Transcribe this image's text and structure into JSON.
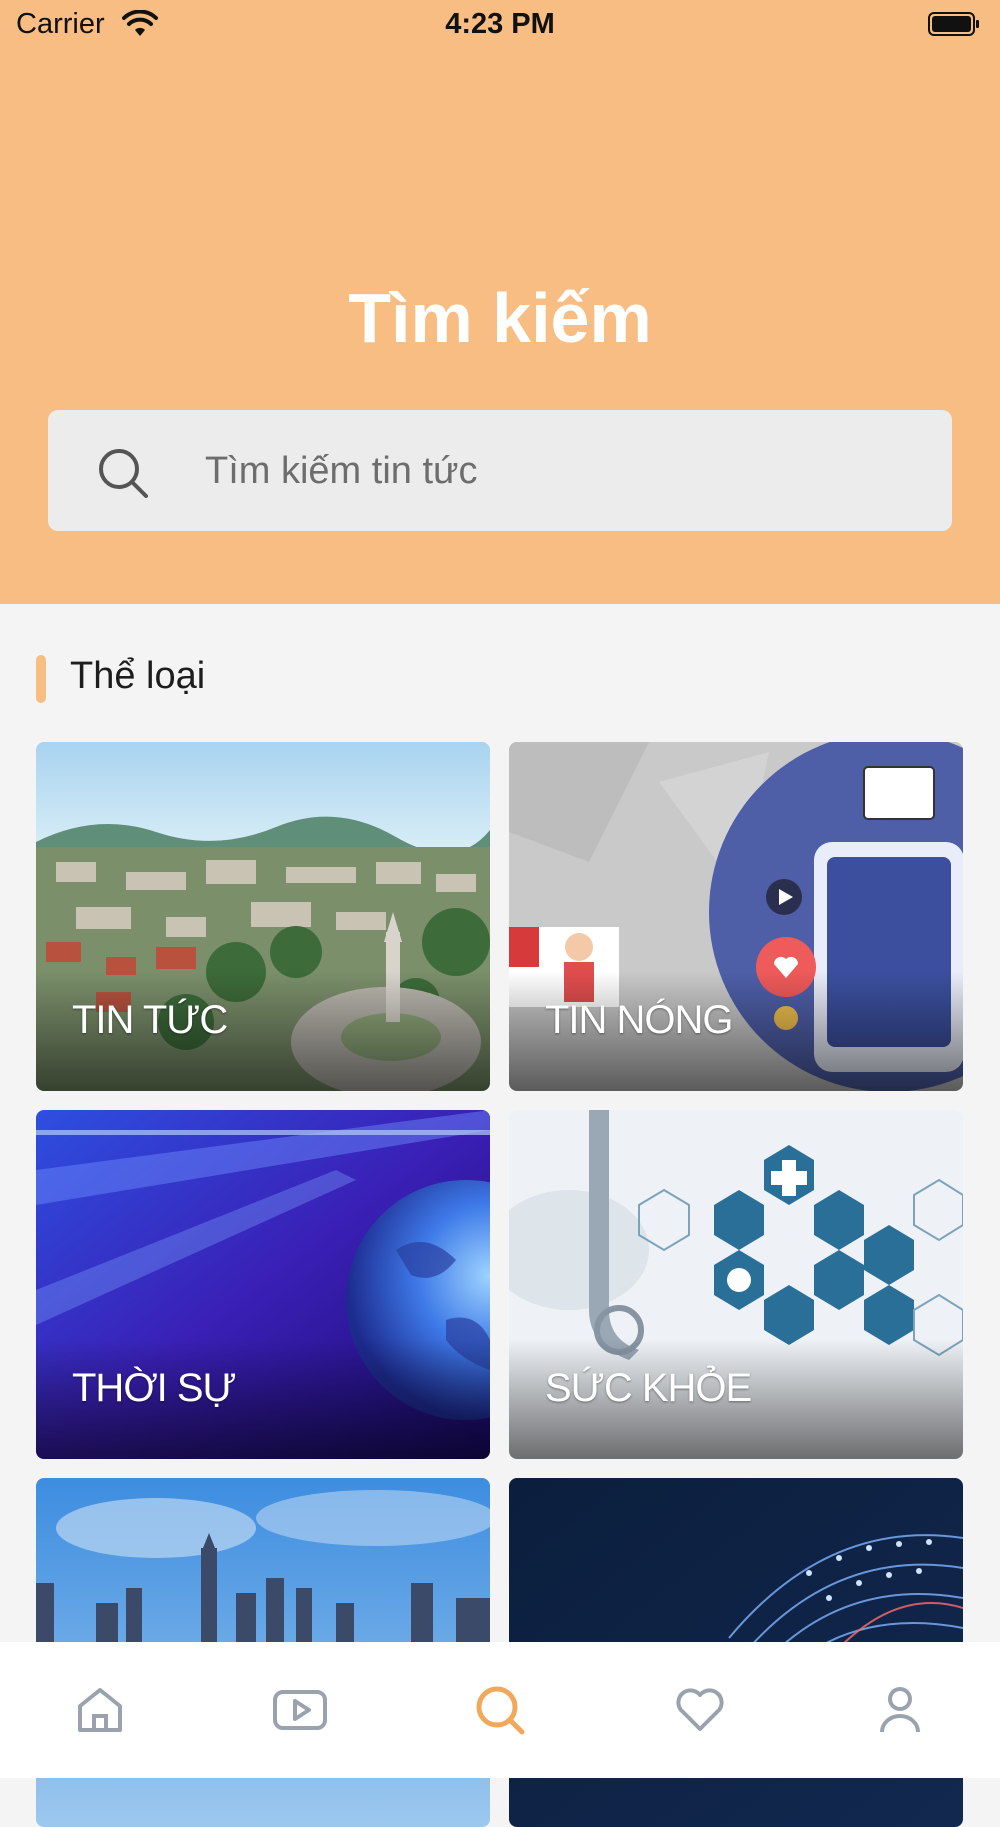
{
  "status_bar": {
    "carrier": "Carrier",
    "time": "4:23 PM"
  },
  "header": {
    "title": "Tìm kiếm"
  },
  "search": {
    "placeholder": "Tìm kiếm tin tức"
  },
  "section": {
    "title": "Thể loại"
  },
  "categories": [
    {
      "label": "TIN TỨC"
    },
    {
      "label": "TIN NÓNG"
    },
    {
      "label": "THỜI SỰ"
    },
    {
      "label": "SỨC KHỎE"
    },
    {
      "label": ""
    },
    {
      "label": ""
    }
  ],
  "tabbar": {
    "items": [
      {
        "icon": "home-icon"
      },
      {
        "icon": "video-icon"
      },
      {
        "icon": "search-icon",
        "active": true
      },
      {
        "icon": "heart-icon"
      },
      {
        "icon": "user-icon"
      }
    ]
  },
  "colors": {
    "accent": "#f7bd83",
    "active_tab": "#f2a85a",
    "inactive_tab": "#9aa3ad"
  }
}
